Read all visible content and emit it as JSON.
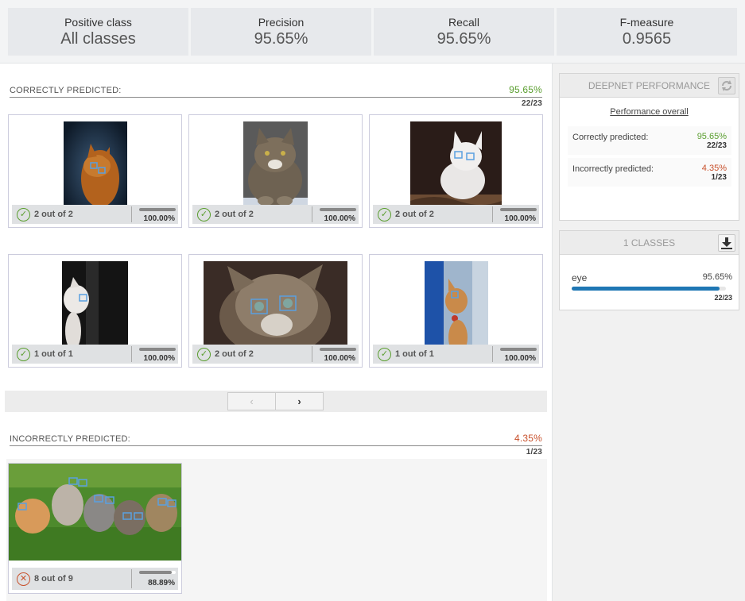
{
  "metrics": [
    {
      "label": "Positive class",
      "value": "All classes"
    },
    {
      "label": "Precision",
      "value": "95.65%"
    },
    {
      "label": "Recall",
      "value": "95.65%"
    },
    {
      "label": "F-measure",
      "value": "0.9565"
    }
  ],
  "correct": {
    "title": "CORRECTLY PREDICTED:",
    "pct": "95.65%",
    "count": "22/23",
    "cards": [
      {
        "text": "2 out of 2",
        "pct": "100.00%",
        "fill": 1.0
      },
      {
        "text": "2 out of 2",
        "pct": "100.00%",
        "fill": 1.0
      },
      {
        "text": "2 out of 2",
        "pct": "100.00%",
        "fill": 1.0
      },
      {
        "text": "1 out of 1",
        "pct": "100.00%",
        "fill": 1.0
      },
      {
        "text": "2 out of 2",
        "pct": "100.00%",
        "fill": 1.0
      },
      {
        "text": "1 out of 1",
        "pct": "100.00%",
        "fill": 1.0
      }
    ]
  },
  "pager": {
    "prev": "‹",
    "next": "›"
  },
  "incorrect": {
    "title": "INCORRECTLY PREDICTED:",
    "pct": "4.35%",
    "count": "1/23",
    "cards": [
      {
        "text": "8 out of 9",
        "pct": "88.89%",
        "fill": 0.8889
      }
    ]
  },
  "performance": {
    "header": "DEEPNET PERFORMANCE",
    "link": "Performance overall",
    "correct_label": "Correctly predicted:",
    "correct_pct": "95.65%",
    "correct_count": "22/23",
    "incorrect_label": "Incorrectly predicted:",
    "incorrect_pct": "4.35%",
    "incorrect_count": "1/23"
  },
  "classes": {
    "header": "1 CLASSES",
    "items": [
      {
        "name": "eye",
        "pct": "95.65%",
        "count": "22/23",
        "fill": 0.9565
      }
    ]
  },
  "colors": {
    "green": "#5a9e2f",
    "red": "#c8502b",
    "blue": "#1f77b4"
  }
}
